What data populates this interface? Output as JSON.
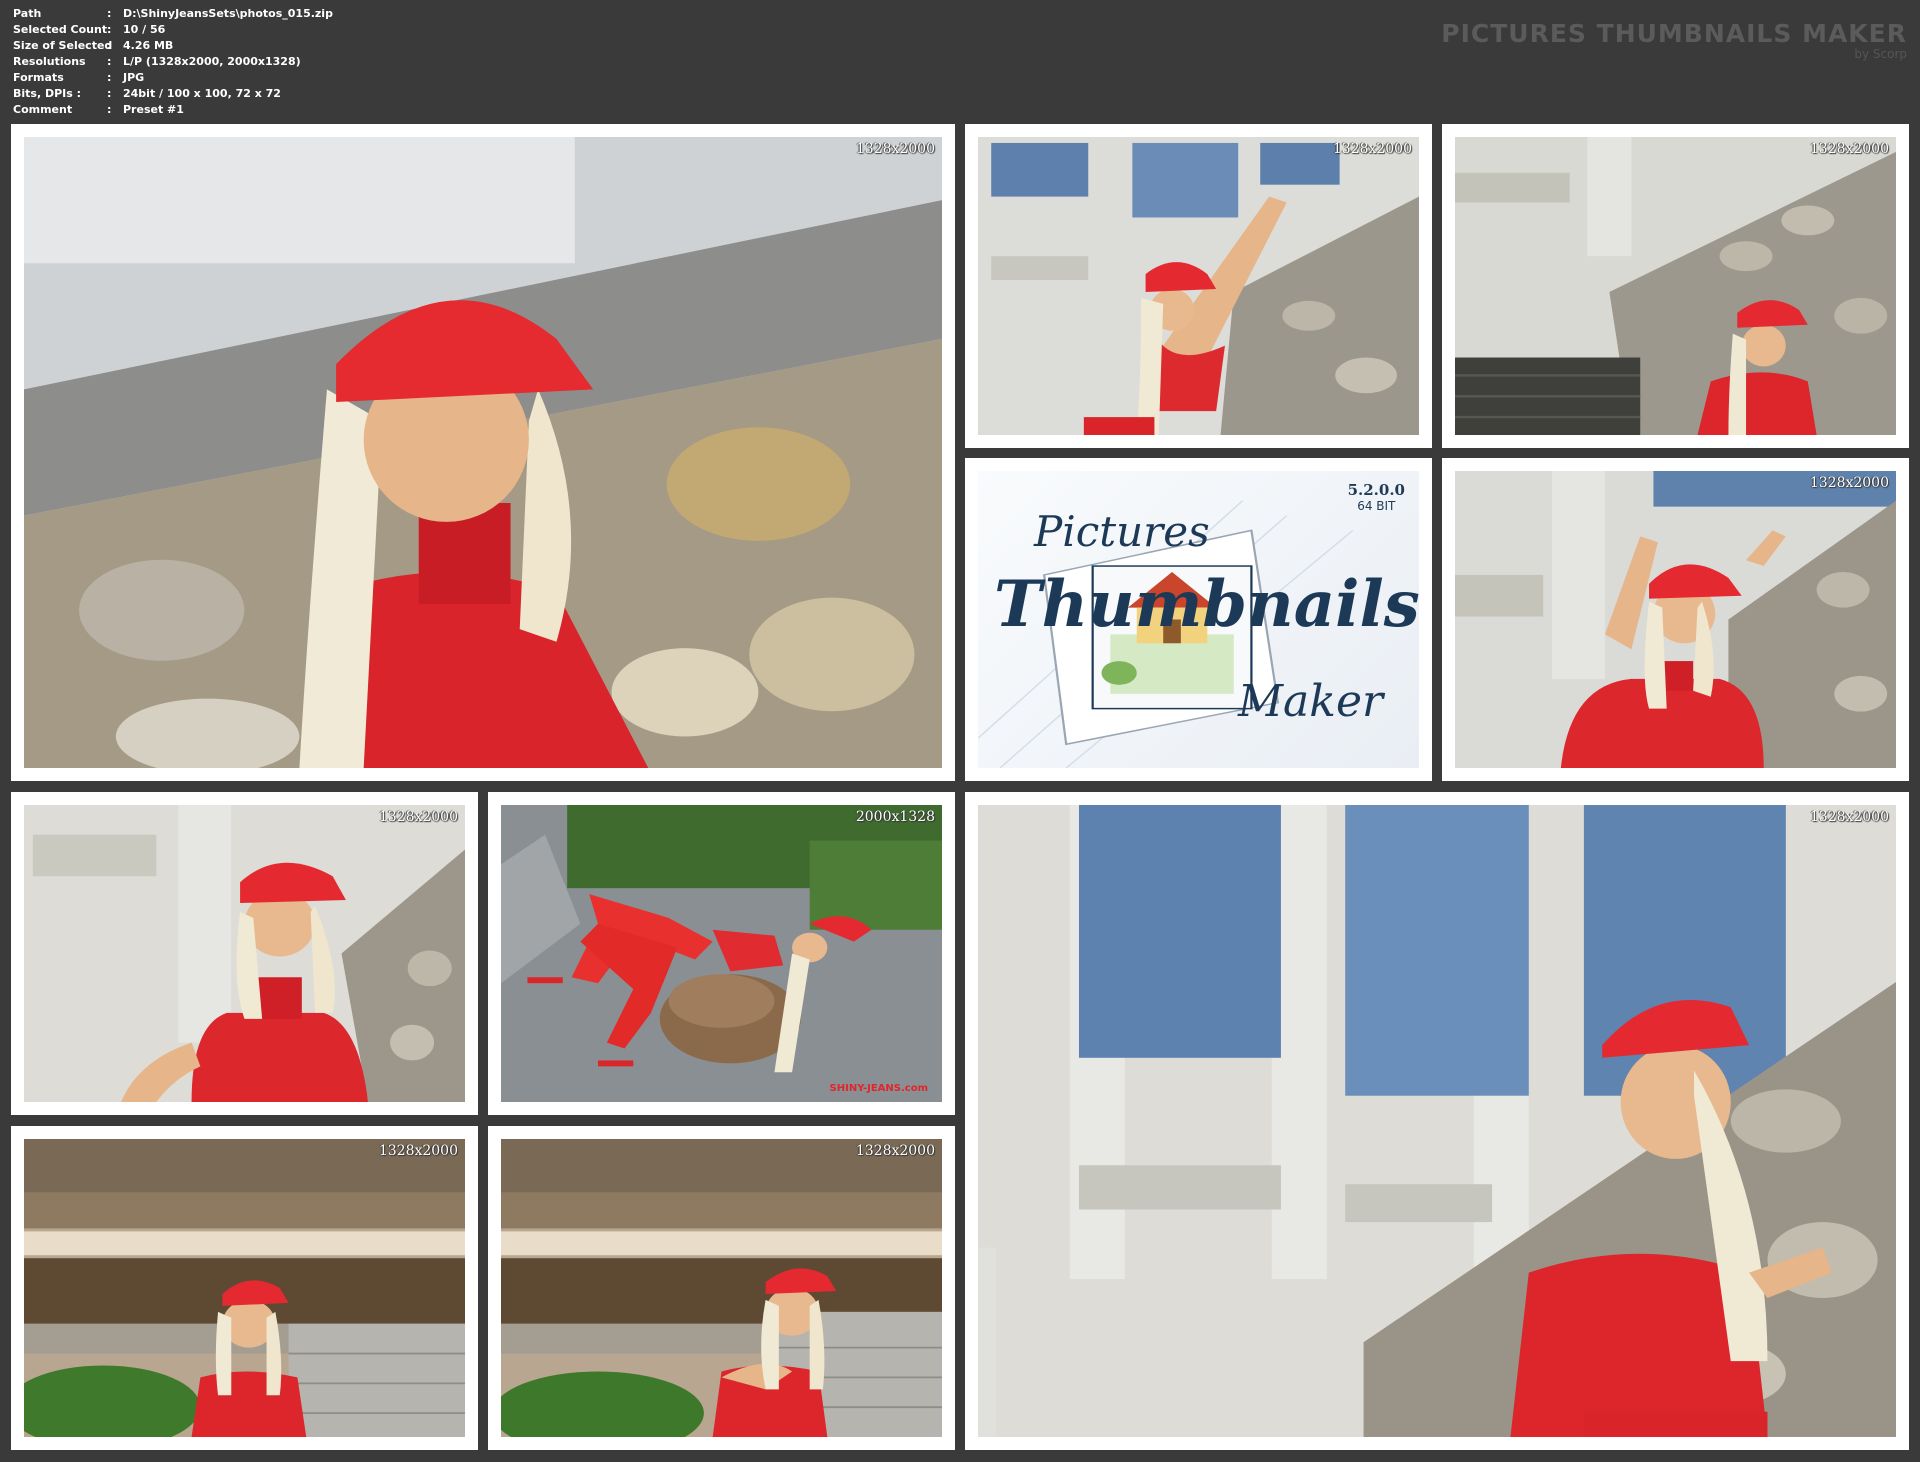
{
  "header": {
    "rows": [
      {
        "key": "Path",
        "value": "D:\\ShinyJeansSets\\photos_015.zip"
      },
      {
        "key": "Selected Count",
        "value": "10 / 56"
      },
      {
        "key": "Size of Selected",
        "value": "4.26 MB"
      },
      {
        "key": "Resolutions",
        "value": "L/P (1328x2000, 2000x1328)"
      },
      {
        "key": "Formats",
        "value": "JPG"
      },
      {
        "key": "Bits, DPIs :",
        "value": "24bit / 100 x 100, 72 x 72"
      },
      {
        "key": "Comment",
        "value": "Preset #1"
      }
    ],
    "separator": ":"
  },
  "brand": {
    "title": "PICTURES THUMBNAILS MAKER",
    "subtitle": "by Scorp"
  },
  "logo": {
    "version": "5.2.0.0",
    "bits": "64 BIT",
    "word1": "Pictures",
    "word2": "Thumbnails",
    "word3": "Maker"
  },
  "thumbs": [
    {
      "resolution": "1328x2000"
    },
    {
      "resolution": "1328x2000"
    },
    {
      "resolution": "1328x2000"
    },
    {
      "resolution": "1328x2000"
    },
    {
      "resolution": "1328x2000"
    },
    {
      "resolution": "2000x1328",
      "credit": "SHINY-JEANS.com"
    },
    {
      "resolution": "1328x2000"
    },
    {
      "resolution": "1328x2000"
    },
    {
      "resolution": "1328x2000"
    }
  ],
  "colors": {
    "background": "#3a3a3a",
    "tile": "#ffffff",
    "accent_red": "#e0262a",
    "logo_blue": "#1c3a57"
  }
}
